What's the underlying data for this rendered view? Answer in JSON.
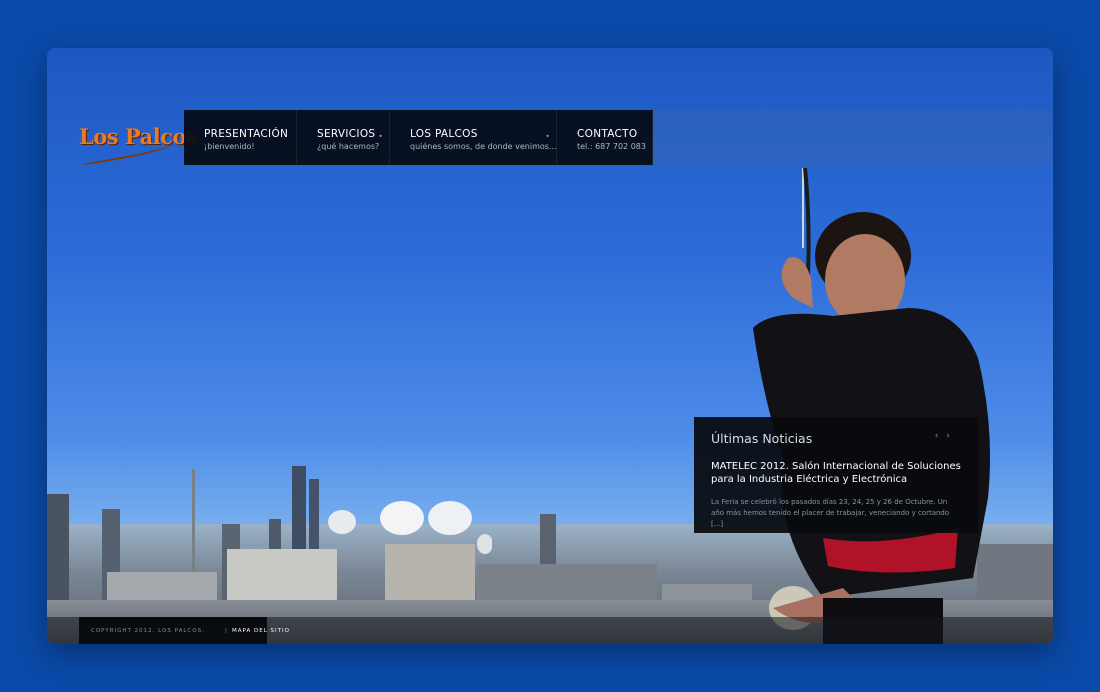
{
  "logo": {
    "text": "Los Palcos"
  },
  "nav": [
    {
      "title": "PRESENTACIÓN",
      "sub": "¡bienvenido!"
    },
    {
      "title": "SERVICIOS",
      "sub": "¿qué hacemos?"
    },
    {
      "title": "LOS PALCOS",
      "sub": "quiénes somos, de donde venimos..."
    },
    {
      "title": "CONTACTO",
      "sub": "tel.: 687 702 083"
    }
  ],
  "news": {
    "heading": "Últimas Noticias",
    "title": "MATELEC 2012. Salón Internacional de Soluciones para la Industria Eléctrica y Electrónica",
    "body": "La Feria se celebró los pasados días 23, 24, 25 y 26 de Octubre. Un año más hemos tenido el placer de trabajar, veneciando y cortando [...]",
    "prev": "‹",
    "next": "›"
  },
  "footer": {
    "copyright": "COPYRIGHT 2012. LOS PALCOS.",
    "separator": "|",
    "sitemap": "MAPA DEL SITIO"
  },
  "colors": {
    "page_bg": "#0a4aa8",
    "logo": "#e87a28",
    "nav_bg": "#050a14"
  }
}
